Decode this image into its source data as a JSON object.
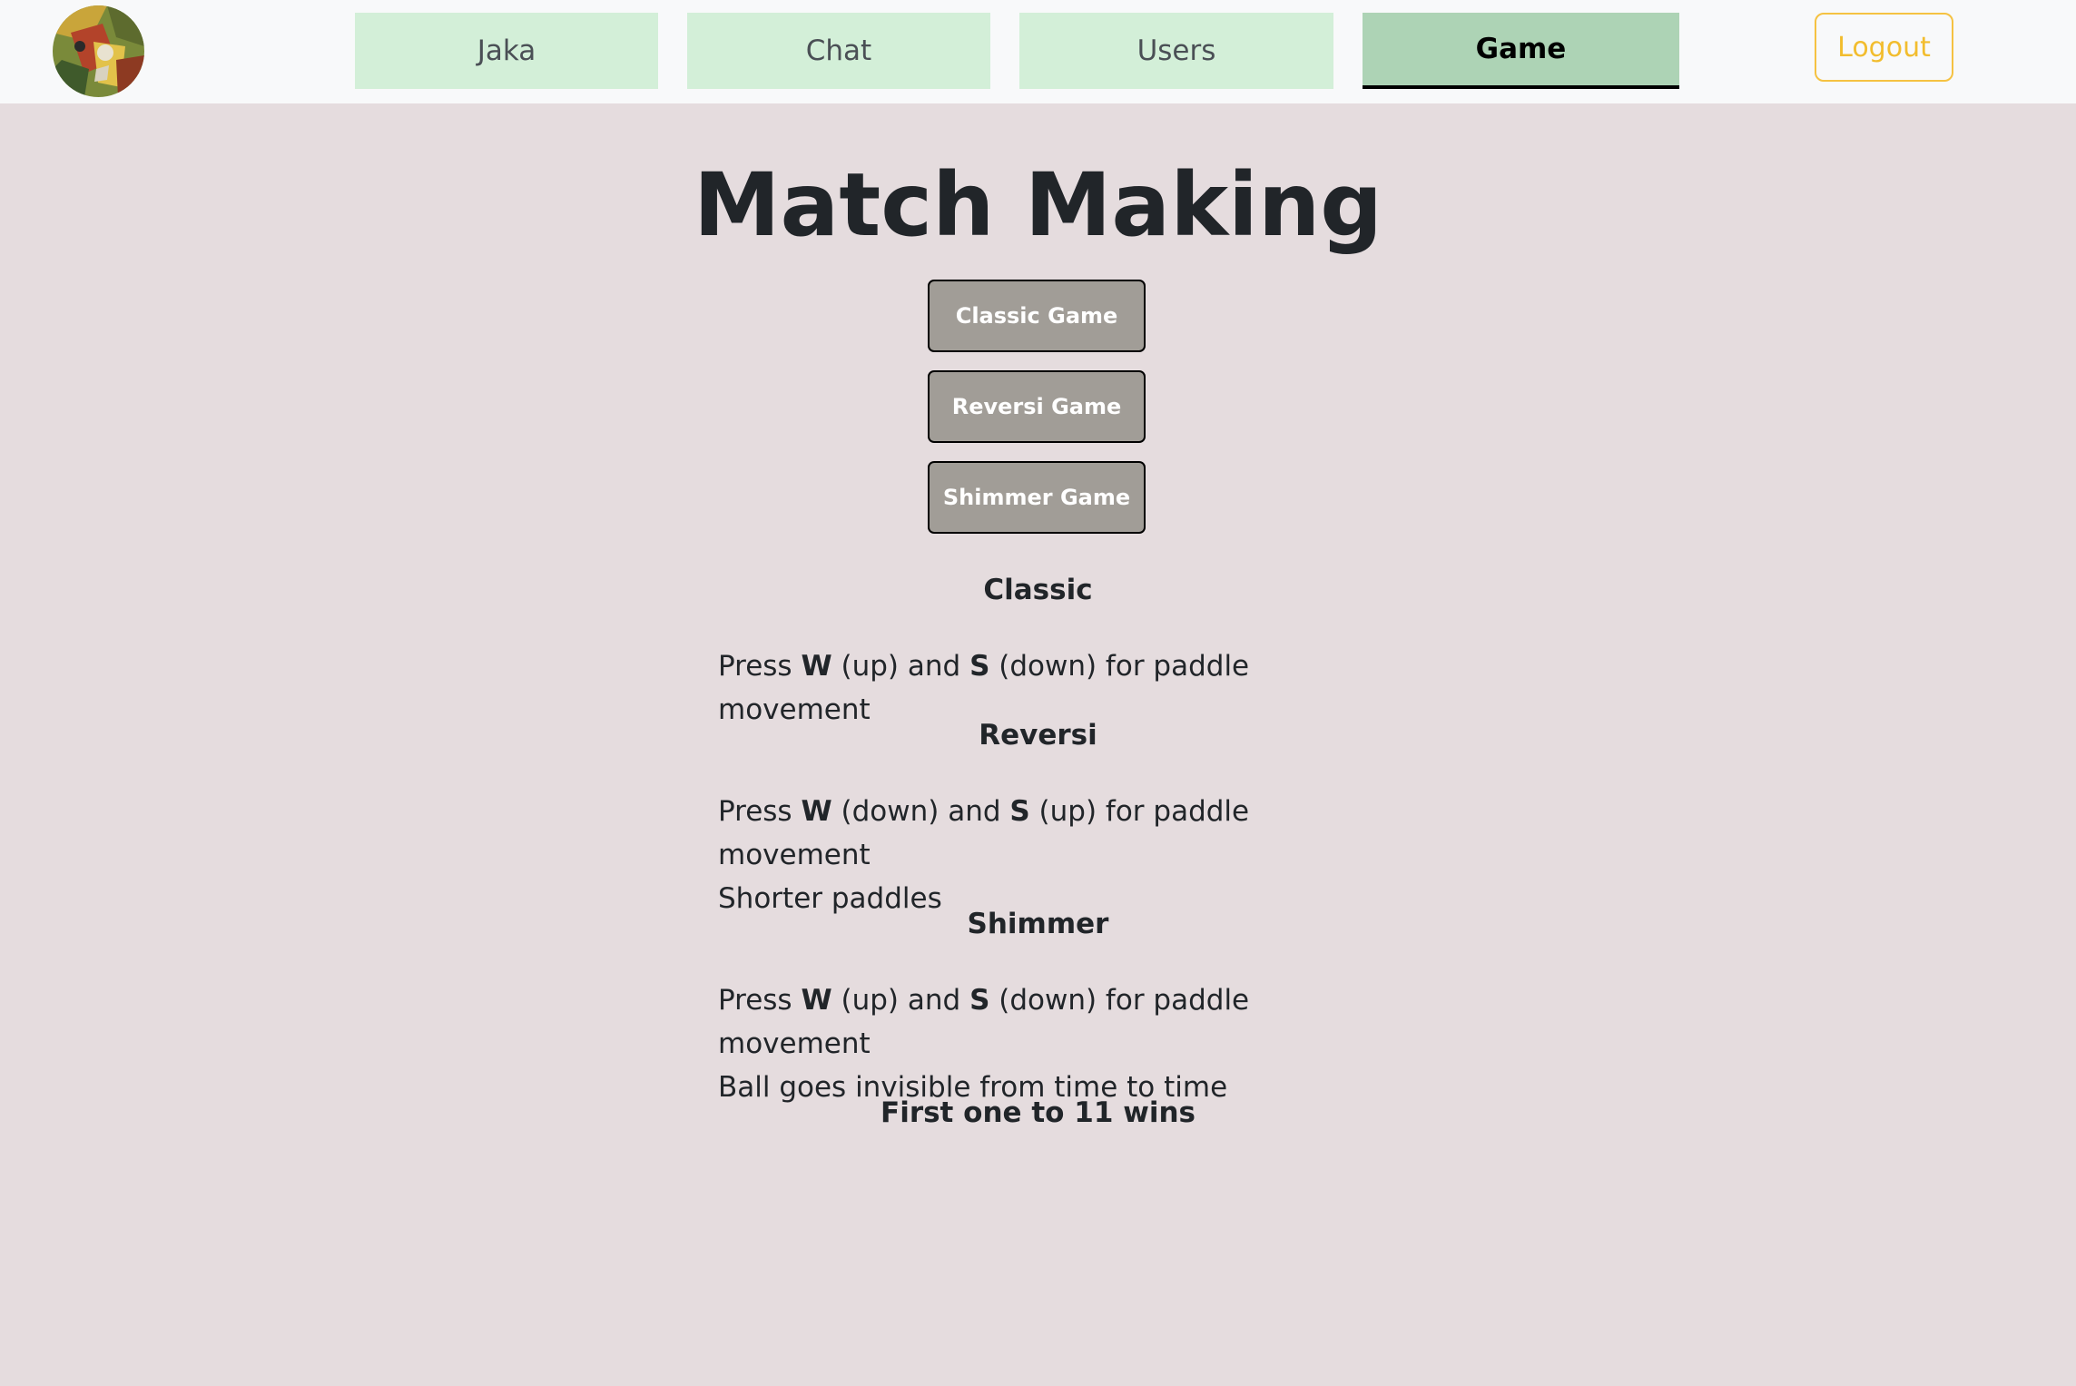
{
  "navbar": {
    "tabs": [
      {
        "label": "Jaka"
      },
      {
        "label": "Chat"
      },
      {
        "label": "Users"
      },
      {
        "label": "Game"
      }
    ],
    "active_tab": "Game",
    "logout_label": "Logout",
    "accent_color": "#f5c242"
  },
  "main": {
    "title": "Match Making",
    "buttons": {
      "classic": "Classic Game",
      "reversi": "Reversi Game",
      "shimmer": "Shimmer Game"
    },
    "modes": {
      "classic": {
        "heading": "Classic",
        "press": "Press ",
        "key1": "W",
        "mid": " (up) and ",
        "key2": "S",
        "tail": " (down) for paddle movement"
      },
      "reversi": {
        "heading": "Reversi",
        "press": "Press ",
        "key1": "W",
        "mid": " (down) and ",
        "key2": "S",
        "tail": " (up) for paddle movement",
        "extra": "Shorter paddles"
      },
      "shimmer": {
        "heading": "Shimmer",
        "press": "Press ",
        "key1": "W",
        "mid": " (up) and ",
        "key2": "S",
        "tail": " (down) for paddle movement",
        "extra": "Ball goes invisible from time to time"
      }
    },
    "footer_note": "First one to 11 wins"
  },
  "colors": {
    "page_background": "#e5dcde",
    "navbar_background": "#f8f9fa",
    "tab_background": "#d3efd8",
    "tab_active_background": "#add3b5",
    "game_button_background": "#a19d97"
  }
}
